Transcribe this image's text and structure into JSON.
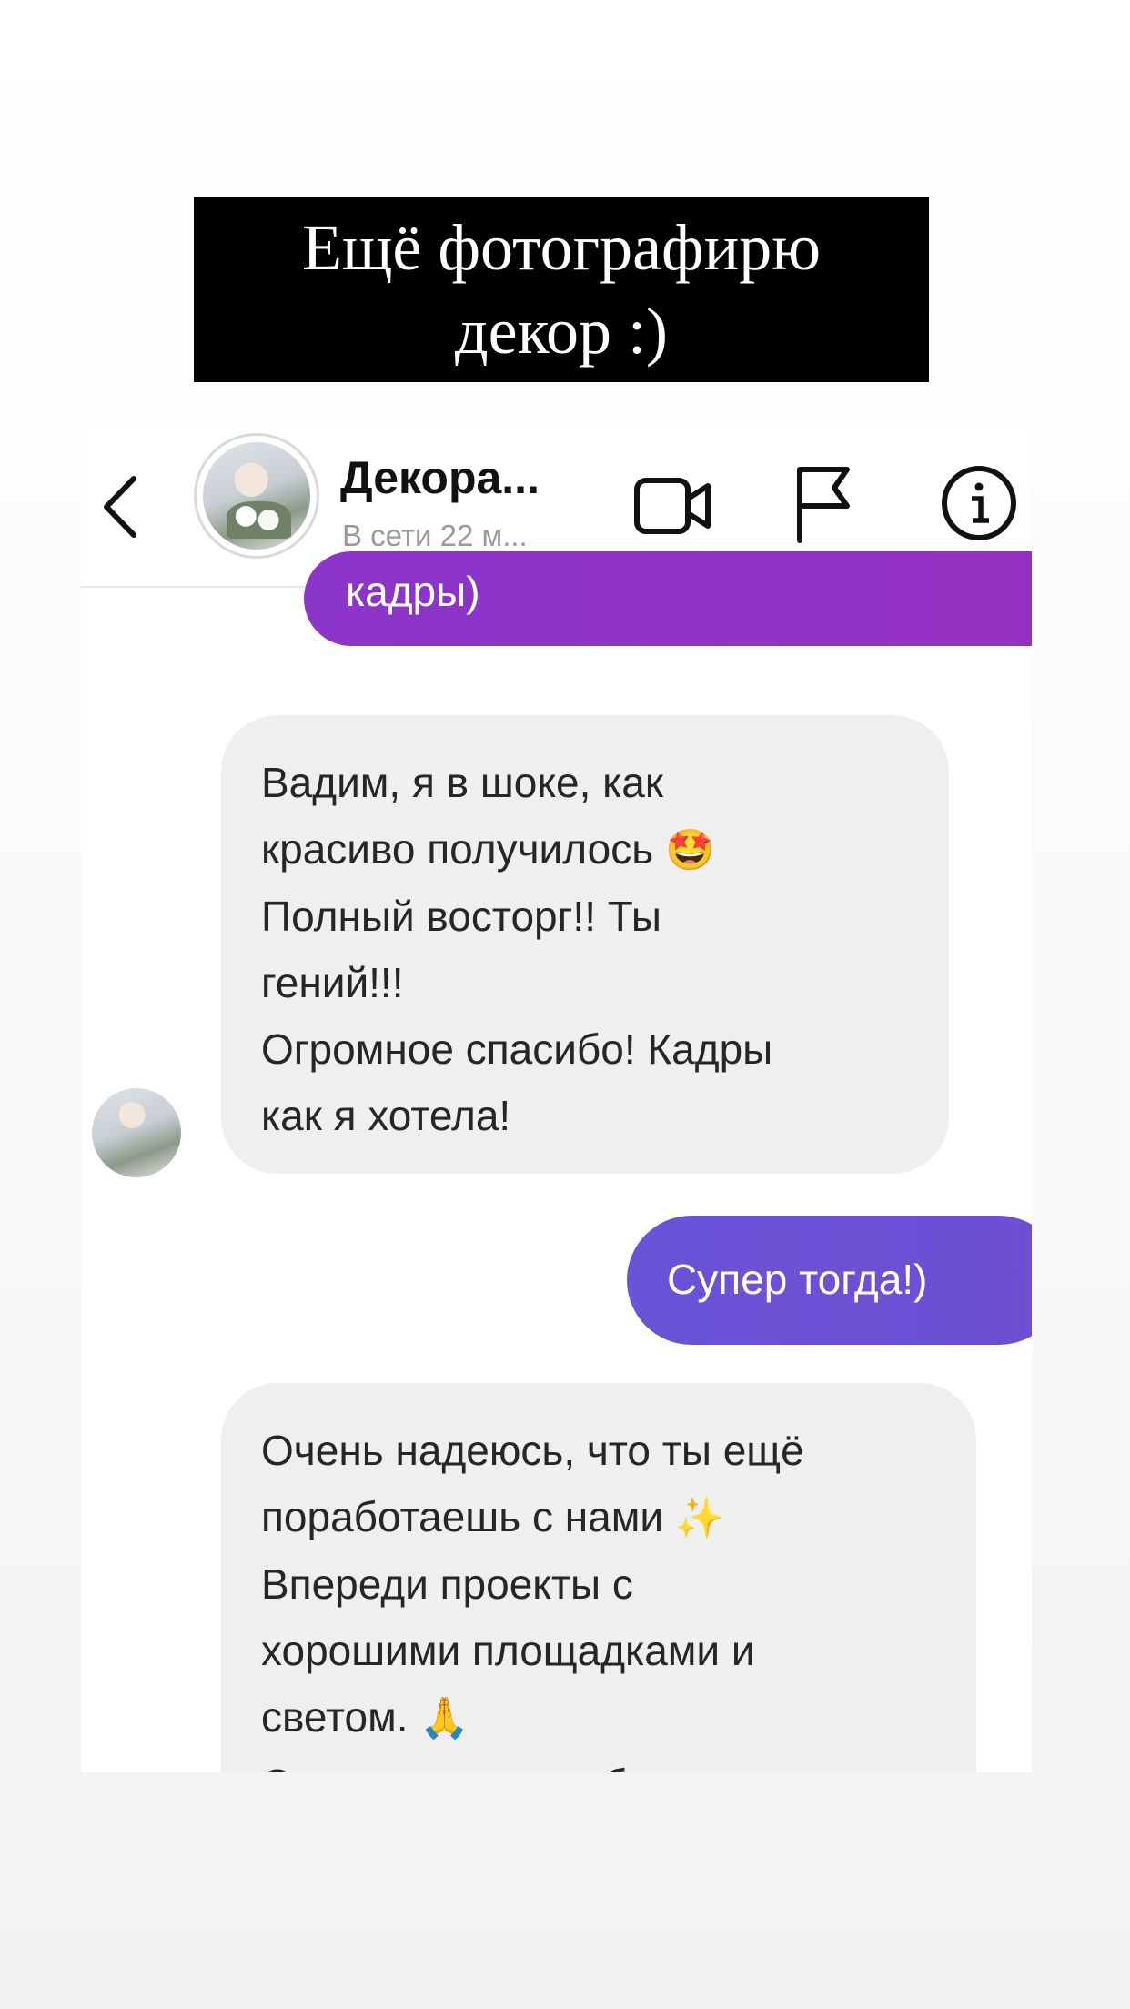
{
  "caption": {
    "line1": "Ещё фотографирю",
    "line2": "декор :)"
  },
  "header": {
    "title": "Декора...",
    "subtitle": "В сети 22 м...",
    "icons": [
      "chevron-left-icon",
      "video-camera-icon",
      "flag-icon",
      "info-icon"
    ]
  },
  "messages": [
    {
      "direction": "outgoing",
      "color": "#8b35c9",
      "lines": [
        "кадры)"
      ]
    },
    {
      "direction": "incoming",
      "lines": [
        "Вадим, я в шоке, как",
        "красиво получилось",
        "Полный восторг!! Ты",
        "гений!!!",
        "Огромное спасибо! Кадры",
        "как я хотела!"
      ],
      "emoji": "🤩"
    },
    {
      "direction": "outgoing",
      "color": "#6a53d6",
      "lines": [
        "Супер тогда!)"
      ]
    },
    {
      "direction": "incoming",
      "lines": [
        "Очень надеюсь, что ты ещё",
        "поработаешь с нами",
        "Впереди проекты с",
        "хорошими площадками и",
        "светом.",
        "Сегодня на свадьбе очень"
      ],
      "emoji_sparkles": "✨",
      "emoji_pray": "🙏"
    }
  ]
}
